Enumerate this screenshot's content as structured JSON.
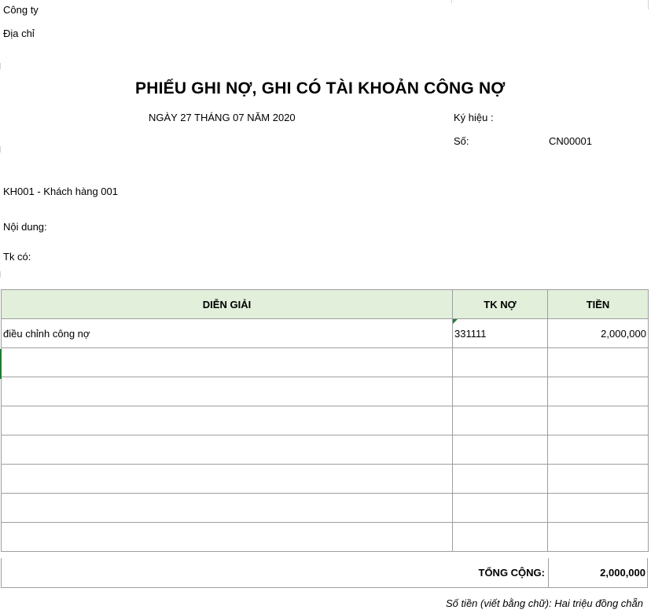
{
  "header": {
    "company": "Công ty",
    "address": "Địa chỉ"
  },
  "document": {
    "title": "PHIẾU GHI NỢ, GHI CÓ TÀI KHOẢN CÔNG NỢ",
    "date": "NGÀY 27 THÁNG 07 NĂM 2020",
    "symbol_label": "Ký hiệu :",
    "number_label": "Số:",
    "number_value": "CN00001",
    "customer": "KH001 - Khách hàng 001",
    "content_label": "Nội dung:",
    "credit_account_label": "Tk có:"
  },
  "table": {
    "columns": [
      "DIỄN GIẢI",
      "TK NỢ",
      "TIỀN"
    ],
    "rows": [
      [
        "điều chỉnh công nợ",
        "331111",
        "2,000,000"
      ],
      [
        "",
        "",
        ""
      ],
      [
        "",
        "",
        ""
      ],
      [
        "",
        "",
        ""
      ],
      [
        "",
        "",
        ""
      ],
      [
        "",
        "",
        ""
      ],
      [
        "",
        "",
        ""
      ],
      [
        "",
        "",
        ""
      ]
    ],
    "total_label": "TỔNG CỘNG:",
    "total_value": "2,000,000"
  },
  "amount_in_words": "Số tiền (viết bằng chữ): Hai triệu đồng chẵn"
}
